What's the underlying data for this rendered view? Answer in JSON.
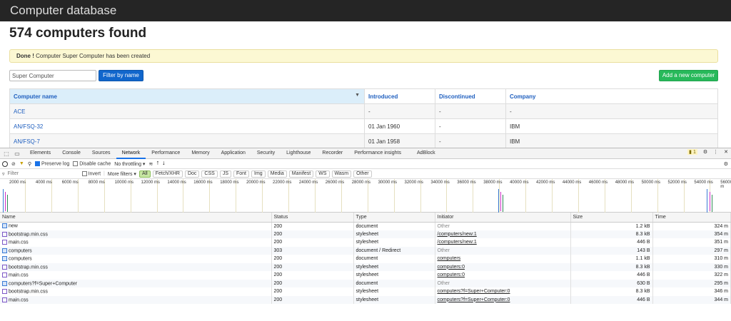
{
  "app": {
    "brand": "Computer database",
    "count_title": "574 computers found",
    "alert_bold": "Done !",
    "alert_text": " Computer Super Computer has been created",
    "filter_value": "Super Computer",
    "filter_button": "Filter by name",
    "add_button": "Add a new computer",
    "columns": [
      "Computer name",
      "Introduced",
      "Discontinued",
      "Company"
    ],
    "rows": [
      {
        "name": "ACE",
        "introduced": "-",
        "discontinued": "-",
        "company": "-"
      },
      {
        "name": "AN/FSQ-32",
        "introduced": "01 Jan 1960",
        "discontinued": "-",
        "company": "IBM"
      },
      {
        "name": "AN/FSQ-7",
        "introduced": "01 Jan 1958",
        "discontinued": "-",
        "company": "IBM"
      }
    ]
  },
  "devtools": {
    "tabs": [
      "Elements",
      "Console",
      "Sources",
      "Network",
      "Performance",
      "Memory",
      "Application",
      "Security",
      "Lighthouse",
      "Recorder",
      "Performance insights",
      "AdBlock"
    ],
    "issues_count": "1",
    "toolbar": {
      "preserve_log": "Preserve log",
      "disable_cache": "Disable cache",
      "throttling": "No throttling"
    },
    "filter_placeholder": "Filter",
    "invert": "Invert",
    "more_filters": "More filters",
    "type_filters": [
      "All",
      "Fetch/XHR",
      "Doc",
      "CSS",
      "JS",
      "Font",
      "Img",
      "Media",
      "Manifest",
      "WS",
      "Wasm",
      "Other"
    ],
    "timeline_labels": [
      "2000 ms",
      "4000 ms",
      "6000 ms",
      "8000 ms",
      "10000 ms",
      "12000 ms",
      "14000 ms",
      "16000 ms",
      "18000 ms",
      "20000 ms",
      "22000 ms",
      "24000 ms",
      "26000 ms",
      "28000 ms",
      "30000 ms",
      "32000 ms",
      "34000 ms",
      "36000 ms",
      "38000 ms",
      "40000 ms",
      "42000 ms",
      "44000 ms",
      "46000 ms",
      "48000 ms",
      "50000 ms",
      "52000 ms",
      "54000 ms",
      "56000 m"
    ],
    "grid_columns": [
      "Name",
      "Status",
      "Type",
      "Initiator",
      "Size",
      "Time"
    ],
    "requests": [
      {
        "name": "new",
        "status": "200",
        "type": "document",
        "initiator": "Other",
        "size": "1.2 kB",
        "time": "324 m",
        "kind": "doc"
      },
      {
        "name": "bootstrap.min.css",
        "status": "200",
        "type": "stylesheet",
        "initiator": "/computers/new:1",
        "size": "8.3 kB",
        "time": "354 m",
        "kind": "css"
      },
      {
        "name": "main.css",
        "status": "200",
        "type": "stylesheet",
        "initiator": "/computers/new:1",
        "size": "446 B",
        "time": "351 m",
        "kind": "css"
      },
      {
        "name": "computers",
        "status": "303",
        "type": "document / Redirect",
        "initiator": "Other",
        "size": "143 B",
        "time": "297 m",
        "kind": "doc"
      },
      {
        "name": "computers",
        "status": "200",
        "type": "document",
        "initiator": "computers",
        "size": "1.1 kB",
        "time": "310 m",
        "kind": "doc"
      },
      {
        "name": "bootstrap.min.css",
        "status": "200",
        "type": "stylesheet",
        "initiator": "computers:0",
        "size": "8.3 kB",
        "time": "330 m",
        "kind": "css"
      },
      {
        "name": "main.css",
        "status": "200",
        "type": "stylesheet",
        "initiator": "computers:0",
        "size": "446 B",
        "time": "322 m",
        "kind": "css"
      },
      {
        "name": "computers?f=Super+Computer",
        "status": "200",
        "type": "document",
        "initiator": "Other",
        "size": "630 B",
        "time": "295 m",
        "kind": "doc"
      },
      {
        "name": "bootstrap.min.css",
        "status": "200",
        "type": "stylesheet",
        "initiator": "computers?f=Super+Computer:0",
        "size": "8.3 kB",
        "time": "346 m",
        "kind": "css"
      },
      {
        "name": "main.css",
        "status": "200",
        "type": "stylesheet",
        "initiator": "computers?f=Super+Computer:0",
        "size": "446 B",
        "time": "344 m",
        "kind": "css"
      }
    ]
  },
  "colors": {
    "primary": "#1166cc",
    "success": "#27b95a",
    "alert_bg": "#fcf8d3",
    "header_bg": "#252525",
    "link": "#1f5fbf"
  }
}
